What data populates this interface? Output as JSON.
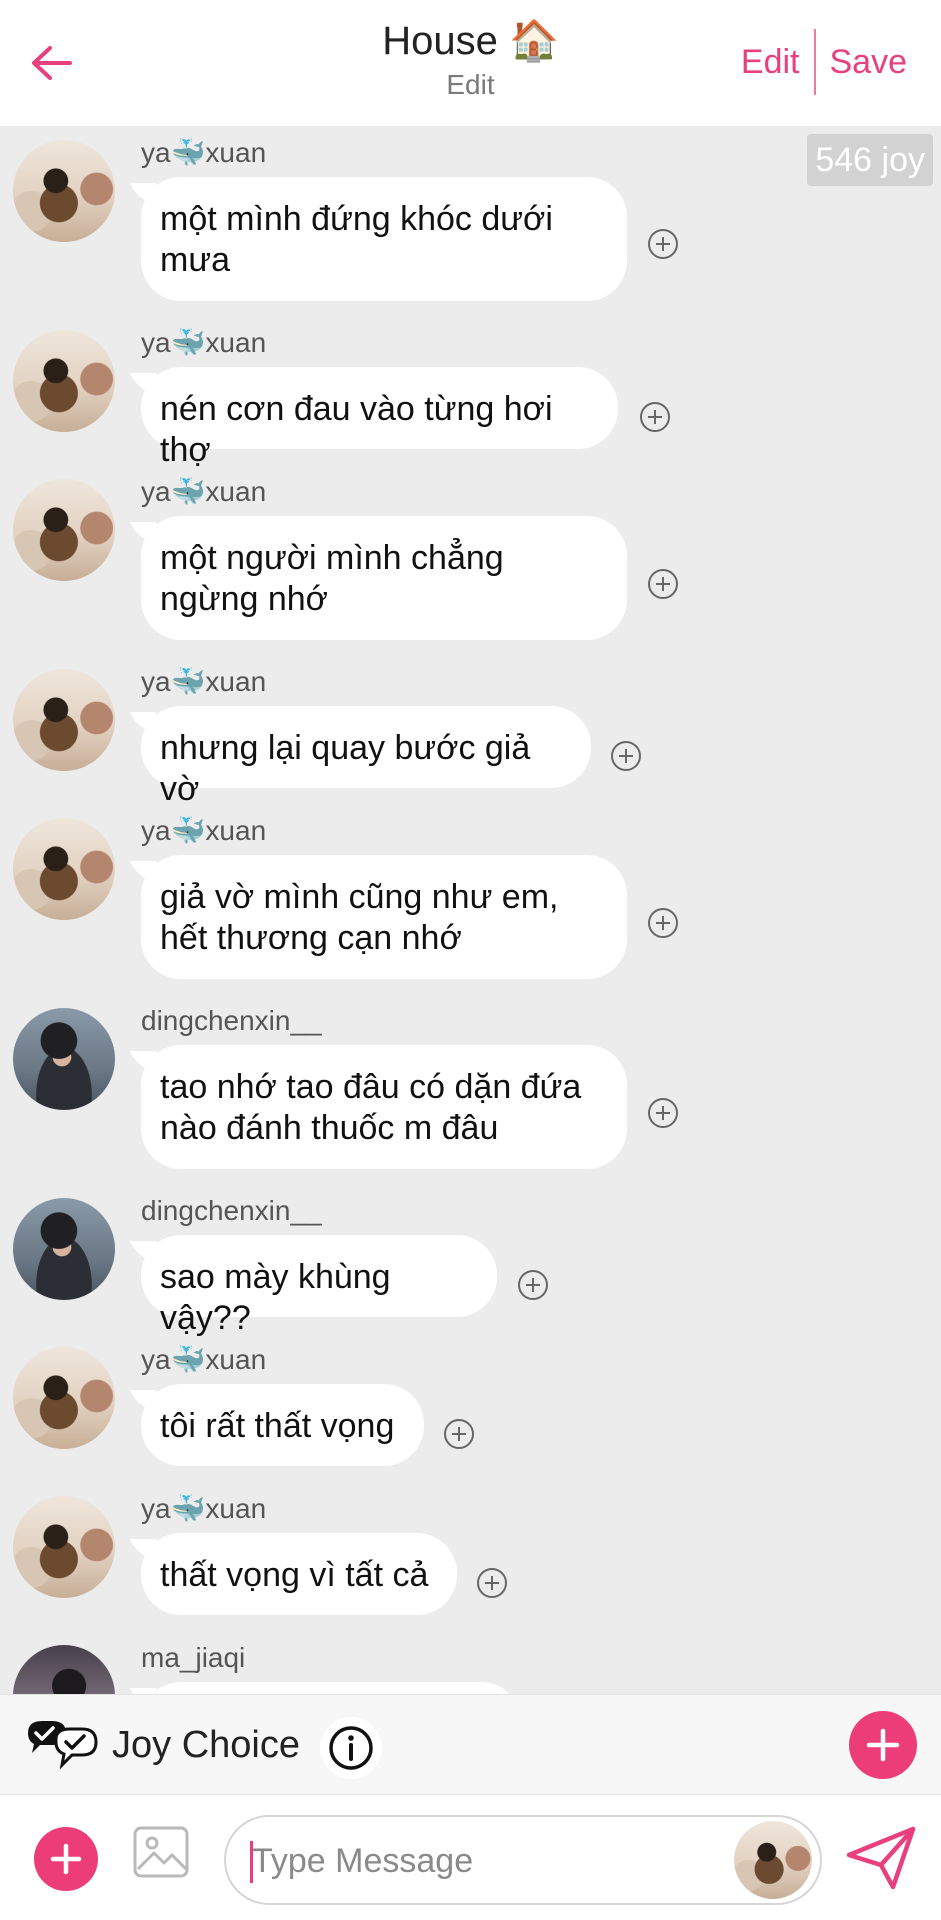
{
  "header": {
    "title": "House 🏠",
    "subtitle": "Edit",
    "edit_label": "Edit",
    "save_label": "Save"
  },
  "badge": "546 joy",
  "messages": [
    {
      "user": "ya🐳xuan",
      "text": "một mình đứng khóc dưới mưa"
    },
    {
      "user": "ya🐳xuan",
      "text": "nén cơn đau vào từng hơi thợ"
    },
    {
      "user": "ya🐳xuan",
      "text": "một người mình chẳng ngừng nhớ"
    },
    {
      "user": "ya🐳xuan",
      "text": "nhưng lại quay bước giả vờ"
    },
    {
      "user": "ya🐳xuan",
      "text": "giả vờ mình cũng như em, hết thương cạn nhớ"
    },
    {
      "user": "dingchenxin__",
      "text": "tao nhớ tao đâu có dặn đứa nào đánh thuốc m đâu"
    },
    {
      "user": "dingchenxin__",
      "text": "sao mày khùng vậy??"
    },
    {
      "user": "ya🐳xuan",
      "text": "tôi rất thất vọng"
    },
    {
      "user": "ya🐳xuan",
      "text": "thất vọng vì tất cả"
    },
    {
      "user": "ma_jiaqi",
      "text": ""
    }
  ],
  "joy_bar": {
    "label": "Joy Choice"
  },
  "input": {
    "placeholder": "Type Message"
  },
  "colors": {
    "accent": "#e8407e",
    "accent_fill": "#ec3d78",
    "chat_background": "#ececec"
  }
}
